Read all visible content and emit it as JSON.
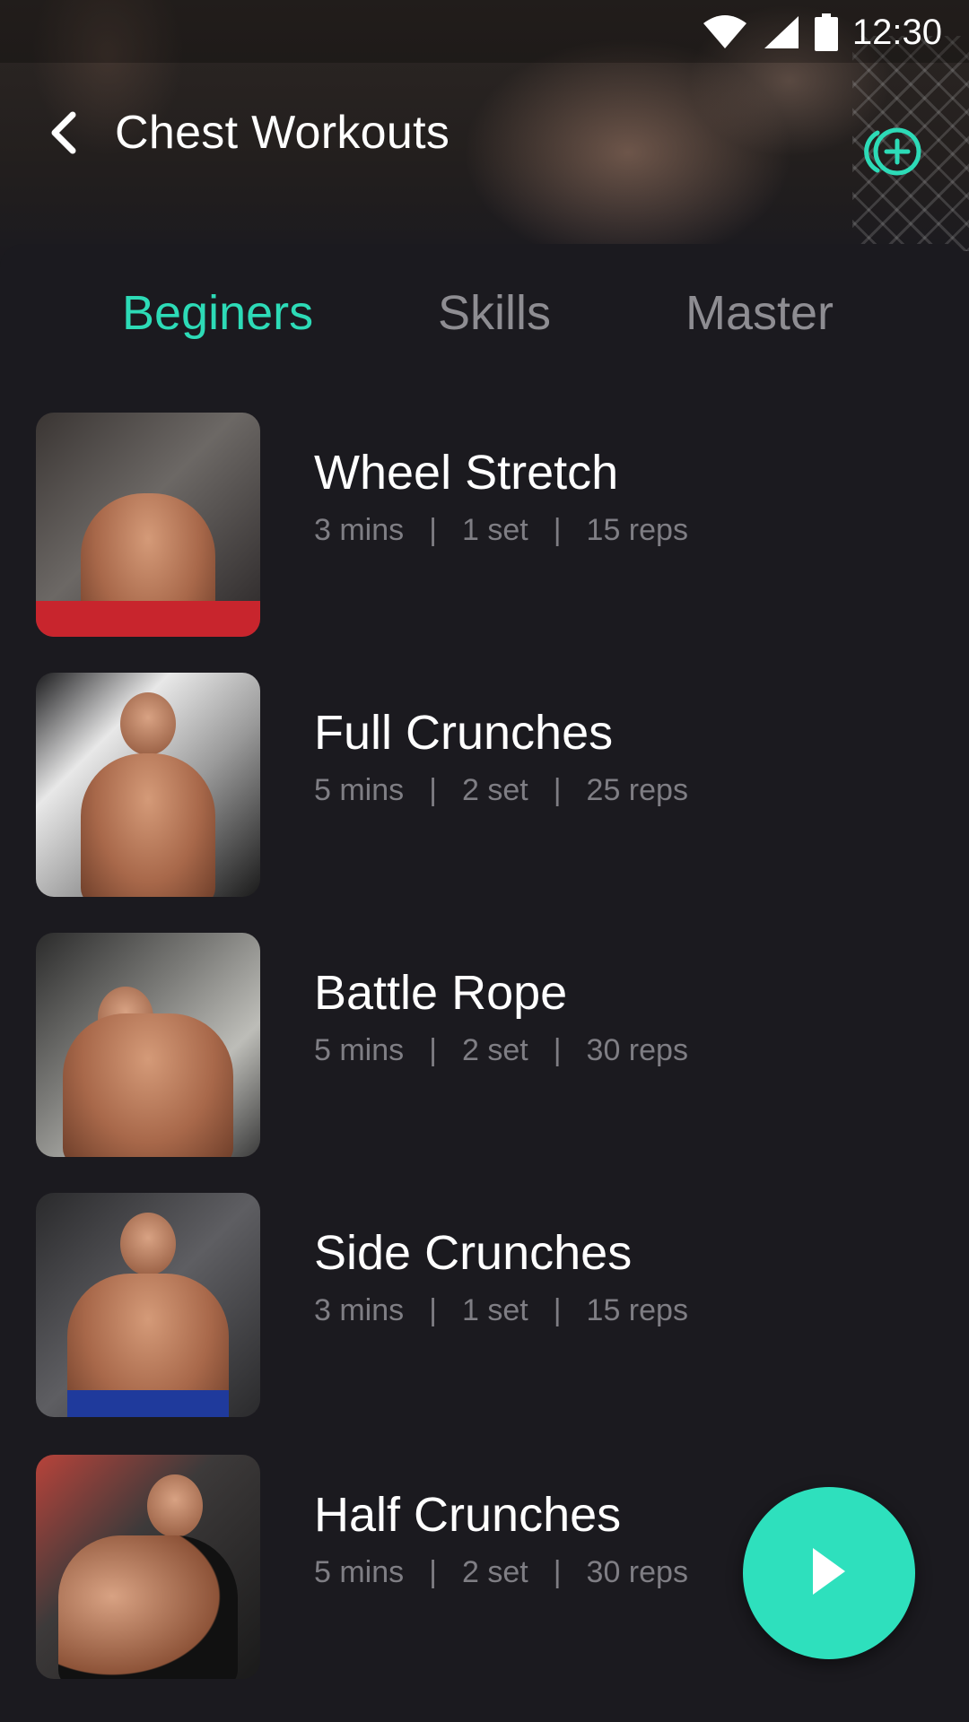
{
  "status_bar": {
    "time": "12:30"
  },
  "header": {
    "title": "Chest Workouts"
  },
  "tabs": [
    {
      "label": "Beginers",
      "active": true
    },
    {
      "label": "Skills",
      "active": false
    },
    {
      "label": "Master",
      "active": false
    }
  ],
  "workouts": [
    {
      "name": "Wheel Stretch",
      "mins": "3 mins",
      "sets": "1 set",
      "reps": "15 reps"
    },
    {
      "name": "Full Crunches",
      "mins": "5 mins",
      "sets": "2 set",
      "reps": "25 reps"
    },
    {
      "name": "Battle Rope",
      "mins": "5 mins",
      "sets": "2 set",
      "reps": "30 reps"
    },
    {
      "name": "Side Crunches",
      "mins": "3 mins",
      "sets": "1 set",
      "reps": "15 reps"
    },
    {
      "name": "Half Crunches",
      "mins": "5 mins",
      "sets": "2 set",
      "reps": "30 reps"
    }
  ],
  "separator": "|",
  "colors": {
    "accent": "#2ddbb7",
    "background": "#1b1a1f",
    "muted": "#7f7e84"
  },
  "icons": {
    "back": "chevron-left-icon",
    "add": "add-circle-icon",
    "play": "play-icon",
    "wifi": "wifi-icon",
    "signal": "signal-icon",
    "battery": "battery-icon"
  }
}
